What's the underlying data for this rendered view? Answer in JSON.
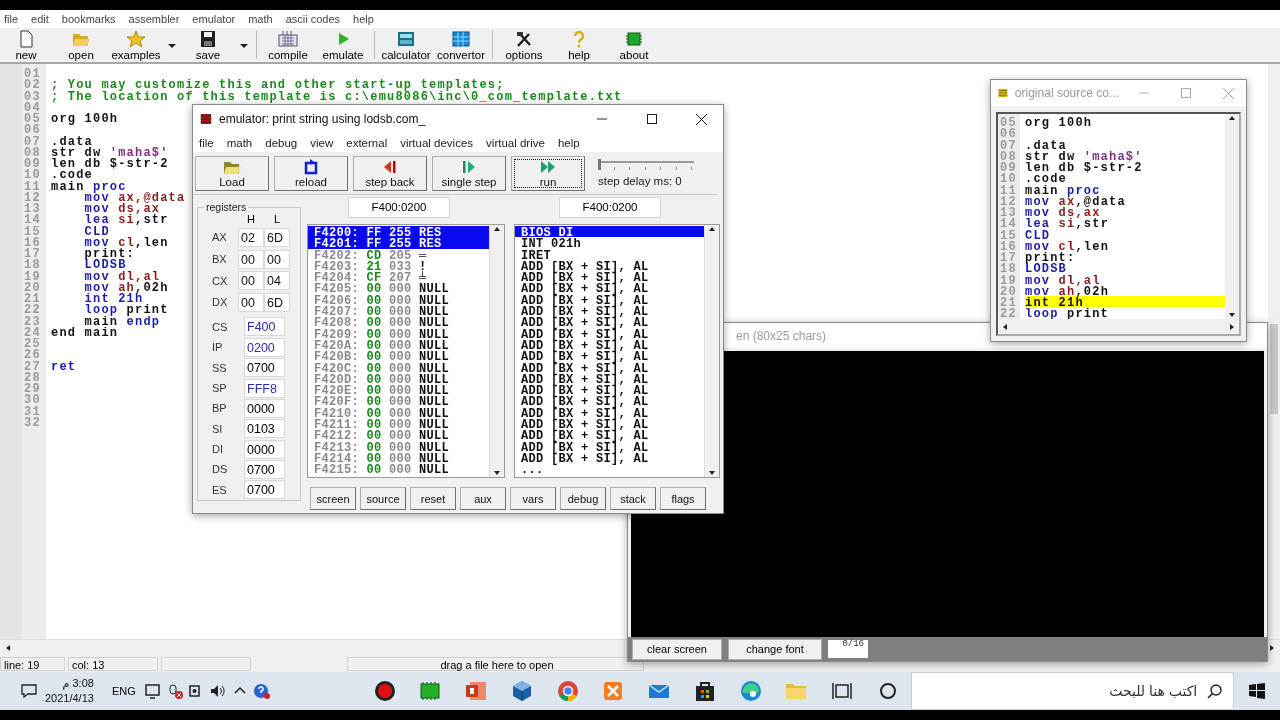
{
  "menu": [
    "file",
    "edit",
    "bookmarks",
    "assembler",
    "emulator",
    "math",
    "ascii codes",
    "help"
  ],
  "toolbar": {
    "groups": [
      [
        {
          "label": "new",
          "kind": "file",
          "dropdown": false
        },
        {
          "label": "open",
          "kind": "folder",
          "dropdown": false
        },
        {
          "label": "examples",
          "kind": "star",
          "dropdown": true
        },
        {
          "label": "save",
          "kind": "disk",
          "dropdown": true
        }
      ],
      [
        {
          "label": "compile",
          "kind": "keyboard",
          "dropdown": false
        },
        {
          "label": "emulate",
          "kind": "play",
          "dropdown": false
        }
      ],
      [
        {
          "label": "calculator",
          "kind": "calculator",
          "dropdown": false
        },
        {
          "label": "convertor",
          "kind": "grid",
          "dropdown": false
        }
      ],
      [
        {
          "label": "options",
          "kind": "tools",
          "dropdown": false
        },
        {
          "label": "help",
          "kind": "question",
          "dropdown": false
        },
        {
          "label": "about",
          "kind": "chip",
          "dropdown": false
        }
      ]
    ]
  },
  "editor": {
    "lines": [
      {
        "num": "01"
      },
      {
        "num": "02",
        "indented": false,
        "tokens": [
          {
            "text": "; You may customize this and other start-up templates;",
            "kind": "comment"
          }
        ]
      },
      {
        "num": "03",
        "indented": false,
        "tokens": [
          {
            "text": "; The location of this template is c:\\emu8086\\inc\\0_com_template.txt",
            "kind": "comment"
          }
        ]
      },
      {
        "num": "04"
      },
      {
        "num": "05",
        "indented": false,
        "tokens": [
          {
            "text": "org 100h",
            "kind": "plain"
          }
        ]
      },
      {
        "num": "06"
      },
      {
        "num": "07",
        "indented": false,
        "tokens": [
          {
            "text": ".data",
            "kind": "plain"
          }
        ]
      },
      {
        "num": "08",
        "indented": false,
        "tokens": [
          {
            "text": "str dw ",
            "kind": "plain"
          },
          {
            "text": "'maha$'",
            "kind": "str"
          }
        ]
      },
      {
        "num": "09",
        "indented": false,
        "tokens": [
          {
            "text": "len db $-str-2",
            "kind": "plain"
          }
        ]
      },
      {
        "num": "10",
        "indented": false,
        "tokens": [
          {
            "text": ".code",
            "kind": "plain"
          }
        ]
      },
      {
        "num": "11",
        "indented": false,
        "tokens": [
          {
            "text": "main ",
            "kind": "plain"
          },
          {
            "text": "proc",
            "kind": "kw"
          }
        ]
      },
      {
        "num": "12",
        "indented": true,
        "tokens": [
          {
            "text": "mov",
            "kind": "kw"
          },
          {
            "text": " ax,@data",
            "kind": "reg"
          }
        ]
      },
      {
        "num": "13",
        "indented": true,
        "tokens": [
          {
            "text": "mov",
            "kind": "kw"
          },
          {
            "text": " ds,ax",
            "kind": "reg"
          }
        ]
      },
      {
        "num": "14",
        "indented": true,
        "tokens": [
          {
            "text": "lea",
            "kind": "kw"
          },
          {
            "text": " si",
            "kind": "reg"
          },
          {
            "text": ",str",
            "kind": "plain"
          }
        ]
      },
      {
        "num": "15",
        "indented": true,
        "tokens": [
          {
            "text": "CLD",
            "kind": "kw"
          }
        ]
      },
      {
        "num": "16",
        "indented": true,
        "tokens": [
          {
            "text": "mov",
            "kind": "kw"
          },
          {
            "text": " cl",
            "kind": "reg"
          },
          {
            "text": ",len",
            "kind": "plain"
          }
        ]
      },
      {
        "num": "17",
        "indented": true,
        "tokens": [
          {
            "text": "print:",
            "kind": "plain"
          }
        ]
      },
      {
        "num": "18",
        "indented": true,
        "tokens": [
          {
            "text": "LODSB",
            "kind": "kw"
          }
        ]
      },
      {
        "num": "19",
        "indented": true,
        "tokens": [
          {
            "text": "mov",
            "kind": "kw"
          },
          {
            "text": " dl,al",
            "kind": "reg"
          }
        ]
      },
      {
        "num": "20",
        "indented": true,
        "tokens": [
          {
            "text": "mov",
            "kind": "kw"
          },
          {
            "text": " ah",
            "kind": "reg"
          },
          {
            "text": ",02h",
            "kind": "plain"
          }
        ]
      },
      {
        "num": "21",
        "indented": true,
        "tokens": [
          {
            "text": "int 21h",
            "kind": "kw"
          }
        ]
      },
      {
        "num": "22",
        "indented": true,
        "tokens": [
          {
            "text": "loop",
            "kind": "kw"
          },
          {
            "text": " print",
            "kind": "plain"
          }
        ]
      },
      {
        "num": "23",
        "indented": true,
        "tokens": [
          {
            "text": "main ",
            "kind": "plain"
          },
          {
            "text": "endp",
            "kind": "kw"
          }
        ]
      },
      {
        "num": "24",
        "indented": false,
        "tokens": [
          {
            "text": "end main",
            "kind": "plain"
          }
        ]
      },
      {
        "num": "25"
      },
      {
        "num": "26"
      },
      {
        "num": "27",
        "indented": false,
        "tokens": [
          {
            "text": "ret",
            "kind": "kw"
          }
        ]
      },
      {
        "num": "28"
      },
      {
        "num": "29"
      },
      {
        "num": "30"
      },
      {
        "num": "31"
      },
      {
        "num": "32"
      }
    ]
  },
  "status_bar": {
    "line": "line: 19",
    "col": "col: 13",
    "hint": "drag a file here to open"
  },
  "emulator": {
    "title": "emulator: print string using lodsb.com_",
    "menu": [
      "file",
      "math",
      "debug",
      "view",
      "external",
      "virtual devices",
      "virtual drive",
      "help"
    ],
    "buttons": [
      {
        "label": "Load",
        "kind": "load",
        "focused": false
      },
      {
        "label": "reload",
        "kind": "reload",
        "focused": false
      },
      {
        "label": "step back",
        "kind": "back",
        "focused": false
      },
      {
        "label": "single step",
        "kind": "step",
        "focused": false
      },
      {
        "label": "run",
        "kind": "run",
        "focused": true
      }
    ],
    "step_delay": {
      "label": "step delay ms: 0",
      "level": 0
    },
    "registers": {
      "title": "registers",
      "h_label": "H",
      "l_label": "L",
      "pairs": [
        {
          "name": "AX",
          "high": "02",
          "low": "6D"
        },
        {
          "name": "BX",
          "high": "00",
          "low": "00"
        },
        {
          "name": "CX",
          "high": "00",
          "low": "04"
        },
        {
          "name": "DX",
          "high": "00",
          "low": "6D"
        }
      ],
      "words": [
        {
          "name": "CS",
          "value": "F400",
          "color": "#2b2bb0"
        },
        {
          "name": "IP",
          "value": "0200",
          "color": "#2b2bb0"
        },
        {
          "name": "SS",
          "value": "0700",
          "color": "#000000"
        },
        {
          "name": "SP",
          "value": "FFF8",
          "color": "#2b2bb0"
        },
        {
          "name": "BP",
          "value": "0000",
          "color": "#000000"
        },
        {
          "name": "SI",
          "value": "0103",
          "color": "#000000"
        },
        {
          "name": "DI",
          "value": "0000",
          "color": "#000000"
        },
        {
          "name": "DS",
          "value": "0700",
          "color": "#000000"
        },
        {
          "name": "ES",
          "value": "0700",
          "color": "#000000"
        }
      ]
    },
    "memory": {
      "address": "F400:0200",
      "rows": [
        {
          "address": "F4200:",
          "hex": "FF",
          "dec": "255",
          "char": "RES",
          "selected": true
        },
        {
          "address": "F4201:",
          "hex": "FF",
          "dec": "255",
          "char": "RES",
          "selected": true
        },
        {
          "address": "F4202:",
          "hex": "CD",
          "dec": "205",
          "char": "═",
          "selected": false
        },
        {
          "address": "F4203:",
          "hex": "21",
          "dec": "033",
          "char": "!",
          "selected": false
        },
        {
          "address": "F4204:",
          "hex": "CF",
          "dec": "207",
          "char": "╧",
          "selected": false
        },
        {
          "address": "F4205:",
          "hex": "00",
          "dec": "000",
          "char": "NULL",
          "selected": false
        },
        {
          "address": "F4206:",
          "hex": "00",
          "dec": "000",
          "char": "NULL",
          "selected": false
        },
        {
          "address": "F4207:",
          "hex": "00",
          "dec": "000",
          "char": "NULL",
          "selected": false
        },
        {
          "address": "F4208:",
          "hex": "00",
          "dec": "000",
          "char": "NULL",
          "selected": false
        },
        {
          "address": "F4209:",
          "hex": "00",
          "dec": "000",
          "char": "NULL",
          "selected": false
        },
        {
          "address": "F420A:",
          "hex": "00",
          "dec": "000",
          "char": "NULL",
          "selected": false
        },
        {
          "address": "F420B:",
          "hex": "00",
          "dec": "000",
          "char": "NULL",
          "selected": false
        },
        {
          "address": "F420C:",
          "hex": "00",
          "dec": "000",
          "char": "NULL",
          "selected": false
        },
        {
          "address": "F420D:",
          "hex": "00",
          "dec": "000",
          "char": "NULL",
          "selected": false
        },
        {
          "address": "F420E:",
          "hex": "00",
          "dec": "000",
          "char": "NULL",
          "selected": false
        },
        {
          "address": "F420F:",
          "hex": "00",
          "dec": "000",
          "char": "NULL",
          "selected": false
        },
        {
          "address": "F4210:",
          "hex": "00",
          "dec": "000",
          "char": "NULL",
          "selected": false
        },
        {
          "address": "F4211:",
          "hex": "00",
          "dec": "000",
          "char": "NULL",
          "selected": false
        },
        {
          "address": "F4212:",
          "hex": "00",
          "dec": "000",
          "char": "NULL",
          "selected": false
        },
        {
          "address": "F4213:",
          "hex": "00",
          "dec": "000",
          "char": "NULL",
          "selected": false
        },
        {
          "address": "F4214:",
          "hex": "00",
          "dec": "000",
          "char": "NULL",
          "selected": false
        },
        {
          "address": "F4215:",
          "hex": "00",
          "dec": "000",
          "char": "NULL",
          "selected": false
        }
      ]
    },
    "disassembly": {
      "address": "F400:0200",
      "rows": [
        {
          "text": "BIOS DI",
          "selected": true
        },
        {
          "text": "INT 021h",
          "selected": false
        },
        {
          "text": "IRET",
          "selected": false
        },
        {
          "text": "ADD [BX + SI], AL",
          "selected": false
        },
        {
          "text": "ADD [BX + SI], AL",
          "selected": false
        },
        {
          "text": "ADD [BX + SI], AL",
          "selected": false
        },
        {
          "text": "ADD [BX + SI], AL",
          "selected": false
        },
        {
          "text": "ADD [BX + SI], AL",
          "selected": false
        },
        {
          "text": "ADD [BX + SI], AL",
          "selected": false
        },
        {
          "text": "ADD [BX + SI], AL",
          "selected": false
        },
        {
          "text": "ADD [BX + SI], AL",
          "selected": false
        },
        {
          "text": "ADD [BX + SI], AL",
          "selected": false
        },
        {
          "text": "ADD [BX + SI], AL",
          "selected": false
        },
        {
          "text": "ADD [BX + SI], AL",
          "selected": false
        },
        {
          "text": "ADD [BX + SI], AL",
          "selected": false
        },
        {
          "text": "ADD [BX + SI], AL",
          "selected": false
        },
        {
          "text": "ADD [BX + SI], AL",
          "selected": false
        },
        {
          "text": "ADD [BX + SI], AL",
          "selected": false
        },
        {
          "text": "ADD [BX + SI], AL",
          "selected": false
        },
        {
          "text": "ADD [BX + SI], AL",
          "selected": false
        },
        {
          "text": "ADD [BX + SI], AL",
          "selected": false
        },
        {
          "text": "...",
          "selected": false
        }
      ]
    },
    "bottom_buttons": [
      "screen",
      "source",
      "reset",
      "aux",
      "vars",
      "debug",
      "stack",
      "flags"
    ]
  },
  "screen_window": {
    "title": "en (80x25 chars)",
    "buttons": [
      "clear screen",
      "change font"
    ],
    "page": "0/16"
  },
  "source_window": {
    "title": "original source co...",
    "lines": [
      {
        "num": "05",
        "tokens": [
          {
            "text": "org 100h",
            "kind": "plain"
          }
        ],
        "highlighted": false
      },
      {
        "num": "06",
        "highlighted": false
      },
      {
        "num": "07",
        "tokens": [
          {
            "text": ".data",
            "kind": "plain"
          }
        ],
        "highlighted": false
      },
      {
        "num": "08",
        "tokens": [
          {
            "text": "str dw ",
            "kind": "plain"
          },
          {
            "text": "'maha$'",
            "kind": "str"
          }
        ],
        "highlighted": false
      },
      {
        "num": "09",
        "tokens": [
          {
            "text": "len db $-str-2",
            "kind": "plain"
          }
        ],
        "highlighted": false
      },
      {
        "num": "10",
        "tokens": [
          {
            "text": ".code",
            "kind": "plain"
          }
        ],
        "highlighted": false
      },
      {
        "num": "11",
        "tokens": [
          {
            "text": "main ",
            "kind": "plain"
          },
          {
            "text": "proc",
            "kind": "kw"
          }
        ],
        "highlighted": false
      },
      {
        "num": "12",
        "tokens": [
          {
            "text": "mov",
            "kind": "kw"
          },
          {
            "text": " ax",
            "kind": "reg"
          },
          {
            "text": ",@data",
            "kind": "plain"
          }
        ],
        "highlighted": false
      },
      {
        "num": "13",
        "tokens": [
          {
            "text": "mov",
            "kind": "kw"
          },
          {
            "text": " ds,ax",
            "kind": "reg"
          }
        ],
        "highlighted": false
      },
      {
        "num": "14",
        "tokens": [
          {
            "text": "lea",
            "kind": "kw"
          },
          {
            "text": " si",
            "kind": "reg"
          },
          {
            "text": ",str",
            "kind": "plain"
          }
        ],
        "highlighted": false
      },
      {
        "num": "15",
        "tokens": [
          {
            "text": "CLD",
            "kind": "kw"
          }
        ],
        "highlighted": false
      },
      {
        "num": "16",
        "tokens": [
          {
            "text": "mov",
            "kind": "kw"
          },
          {
            "text": " cl",
            "kind": "reg"
          },
          {
            "text": ",len",
            "kind": "plain"
          }
        ],
        "highlighted": false
      },
      {
        "num": "17",
        "tokens": [
          {
            "text": "print:",
            "kind": "plain"
          }
        ],
        "highlighted": false
      },
      {
        "num": "18",
        "tokens": [
          {
            "text": "LODSB",
            "kind": "kw"
          }
        ],
        "highlighted": false
      },
      {
        "num": "19",
        "tokens": [
          {
            "text": "mov",
            "kind": "kw"
          },
          {
            "text": " dl,al",
            "kind": "reg"
          }
        ],
        "highlighted": false
      },
      {
        "num": "20",
        "tokens": [
          {
            "text": "mov",
            "kind": "kw"
          },
          {
            "text": " ah",
            "kind": "reg"
          },
          {
            "text": ",02h",
            "kind": "plain"
          }
        ],
        "highlighted": false
      },
      {
        "num": "21",
        "tokens": [
          {
            "text": "int 21h",
            "kind": "plain"
          }
        ],
        "highlighted": true
      },
      {
        "num": "22",
        "tokens": [
          {
            "text": "loop",
            "kind": "kw"
          },
          {
            "text": " print",
            "kind": "plain"
          }
        ],
        "highlighted": false
      }
    ]
  },
  "taskbar": {
    "time": "3:08 م",
    "date": "2021/4/13",
    "language": "ENG",
    "tray": [
      {
        "kind": "screen"
      },
      {
        "kind": "mic-off"
      },
      {
        "kind": "camera"
      },
      {
        "kind": "volume"
      },
      {
        "kind": "chevron"
      },
      {
        "kind": "help"
      }
    ],
    "apps": [
      {
        "kind": "record"
      },
      {
        "kind": "chip"
      },
      {
        "kind": "slides"
      },
      {
        "kind": "cube"
      },
      {
        "kind": "browser"
      },
      {
        "kind": "orange"
      },
      {
        "kind": "mail"
      },
      {
        "kind": "bag"
      },
      {
        "kind": "edge"
      },
      {
        "kind": "folder"
      },
      {
        "kind": "taskview"
      },
      {
        "kind": "ring"
      }
    ],
    "search": {
      "placeholder": "اكتب هنا للبحث"
    }
  }
}
